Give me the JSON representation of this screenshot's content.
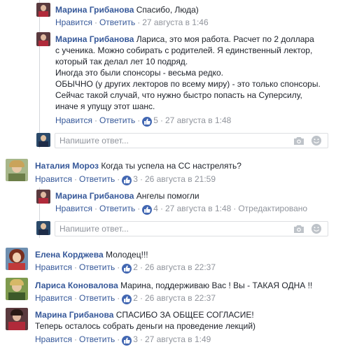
{
  "colors": {
    "link": "#365899",
    "meta": "#90949c",
    "like": "#4267b2",
    "border": "#dddfe2"
  },
  "action_labels": {
    "like": "Нравится",
    "reply": "Ответить"
  },
  "reply_placeholder": "Напишите ответ...",
  "comments": [
    {
      "author": "Марина Грибанова",
      "lines": [
        "Спасибо, Люда)"
      ],
      "likes": null,
      "time": "27 августа в 1:46",
      "edited": null
    },
    {
      "author": "Марина Грибанова",
      "lines": [
        "Лариса, это моя работа. Расчет по 2 доллара",
        "с ученика. Можно собирать с родителей. Я единственный лектор,",
        "который так делал лет 10 подряд.",
        "Иногда это были спонсоры - весьма редко.",
        "ОБЫЧНО (у других лекторов по всему миру) - это только спонсоры.",
        "Сейчас такой случай, что нужно быстро попасть на Суперсилу,",
        "иначе я упущу этот шанс."
      ],
      "likes": "5",
      "time": "27 августа в 1:48",
      "edited": null
    },
    {
      "author": "Наталия Мороз",
      "lines": [
        "Когда ты успела на СС настрелять?"
      ],
      "likes": "3",
      "time": "26 августа в 21:59",
      "edited": null
    },
    {
      "author": "Марина Грибанова",
      "lines": [
        "Ангелы помогли"
      ],
      "likes": "4",
      "time": "27 августа в 1:48",
      "edited": "Отредактировано"
    },
    {
      "author": "Елена Корджева",
      "lines": [
        "Молодец!!!"
      ],
      "likes": "2",
      "time": "26 августа в 22:37",
      "edited": null
    },
    {
      "author": "Лариса Коновалова",
      "lines": [
        "Марина, поддерживаю Вас ! Вы - ТАКАЯ ОДНА !!"
      ],
      "likes": "2",
      "time": "26 августа в 22:37",
      "edited": null
    },
    {
      "author": "Марина Грибанова",
      "lines": [
        "СПАСИБО ЗА ОБЩЕЕ СОГЛАСИЕ!",
        "Теперь осталось собрать деньги на проведение лекций)"
      ],
      "likes": "3",
      "time": "27 августа в 1:49",
      "edited": null
    }
  ]
}
